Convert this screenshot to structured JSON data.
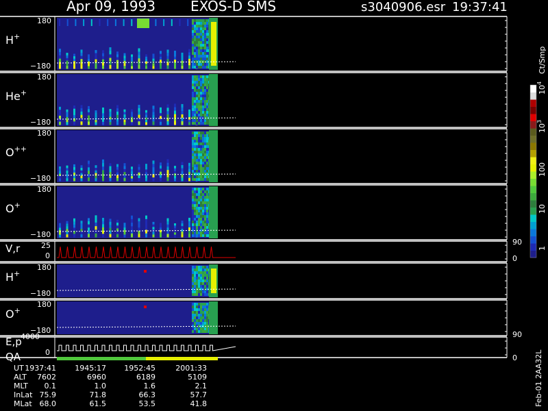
{
  "header": {
    "date": "Apr 09, 1993",
    "mission": "EXOS-D SMS",
    "file": "s3040906.esr",
    "time": "19:37:41"
  },
  "chart_data": [
    {
      "type": "heatmap",
      "panels": [
        {
          "id": "h1",
          "label": "H",
          "superscript": "+",
          "y_top": "180",
          "y_bottom": "−180",
          "ylim": [
            -180,
            180
          ]
        },
        {
          "id": "he1",
          "label": "He",
          "superscript": "+",
          "y_top": "180",
          "y_bottom": "−180",
          "ylim": [
            -180,
            180
          ]
        },
        {
          "id": "opp",
          "label": "O",
          "superscript": "++",
          "y_top": "180",
          "y_bottom": "−180",
          "ylim": [
            -180,
            180
          ]
        },
        {
          "id": "op1",
          "label": "O",
          "superscript": "+",
          "y_top": "180",
          "y_bottom": "−180",
          "ylim": [
            -180,
            180
          ]
        },
        {
          "id": "h2",
          "label": "H",
          "superscript": "+",
          "y_top": "180",
          "y_bottom": "−180",
          "ylim": [
            -180,
            180
          ]
        },
        {
          "id": "op2",
          "label": "O",
          "superscript": "+",
          "y_top": "180",
          "y_bottom": "−180",
          "ylim": [
            -180,
            180
          ]
        }
      ],
      "colorbar": {
        "label": "Ct/Smp",
        "ticks": [
          {
            "base": "1",
            "exp": ""
          },
          {
            "base": "10",
            "exp": ""
          },
          {
            "base": "100",
            "exp": ""
          },
          {
            "base": "10",
            "exp": "3"
          },
          {
            "base": "10",
            "exp": "4"
          }
        ],
        "range": [
          1,
          10000
        ],
        "scale": "log",
        "colors": [
          "#1e1e8c",
          "#1e2ab4",
          "#1450d2",
          "#0a78dc",
          "#00a0d2",
          "#00c8c8",
          "#28a050",
          "#2d7d3c",
          "#3caa3c",
          "#50c83c",
          "#78dc32",
          "#aaf028",
          "#e6f000",
          "#f0f014",
          "#b4a000",
          "#8c7800",
          "#6e6e28",
          "#5a5a1e",
          "#8b1a1a",
          "#e00000",
          "#780000",
          "#b00000",
          "#dcdcdc",
          "#ffffff"
        ]
      }
    },
    {
      "type": "line",
      "panel": "vr",
      "label": "V,r",
      "y_left_top": "25",
      "y_left_bottom": "0",
      "y_right_top": "90",
      "y_right_bottom": "0",
      "ylim": [
        0,
        25
      ],
      "color": "#e00000"
    },
    {
      "type": "line",
      "panel": "ep",
      "label": "E,p",
      "y_left_top": "4000",
      "y_left_bottom": "0",
      "y_right_top": "90",
      "y_right_bottom": "0",
      "ylim": [
        0,
        4000
      ],
      "color": "#ffffff"
    },
    {
      "type": "bar",
      "panel": "qa",
      "label": "QA"
    }
  ],
  "ephemeris": {
    "rows": [
      {
        "label": "UT",
        "values": [
          "1937:41",
          "1945:17",
          "1952:45",
          "2001:33"
        ]
      },
      {
        "label": "ALT",
        "values": [
          "7602",
          "6960",
          "6189",
          "5109"
        ]
      },
      {
        "label": "MLT",
        "values": [
          "0.1",
          "1.0",
          "1.6",
          "2.1"
        ]
      },
      {
        "label": "InLat",
        "values": [
          "75.9",
          "71.8",
          "66.3",
          "57.7"
        ]
      },
      {
        "label": "MLat",
        "values": [
          "68.0",
          "61.5",
          "53.5",
          "41.8"
        ]
      }
    ]
  },
  "footer_note": "Feb-01 2AA32L"
}
